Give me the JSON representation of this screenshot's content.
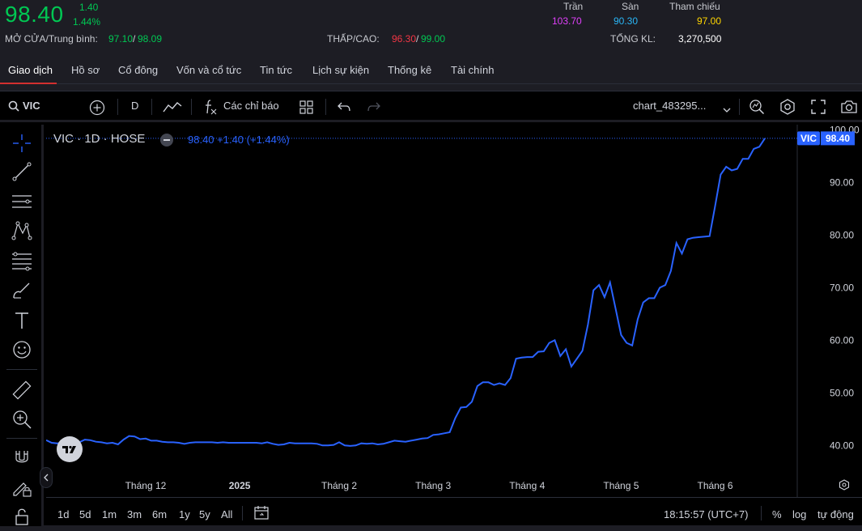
{
  "quote": {
    "price": "98.40",
    "change": "1.40",
    "change_pct": "1.44%",
    "open_avg_label": "MỞ CỬA/Trung bình:",
    "open": "97.10",
    "sep": "/",
    "avg": "98.09",
    "lowhigh_label": "THẤP/CAO:",
    "low": "96.30",
    "high": "99.00",
    "ceiling_label": "Trần",
    "ceiling": "103.70",
    "floor_label": "Sàn",
    "floor": "90.30",
    "ref_label": "Tham chiếu",
    "ref": "97.00",
    "vol_label": "TỔNG KL:",
    "volume": "3,270,500"
  },
  "tabs": [
    "Giao dịch",
    "Hồ sơ",
    "Cổ đông",
    "Vốn và cổ tức",
    "Tin tức",
    "Lịch sự kiện",
    "Thống kê",
    "Tài chính"
  ],
  "toolbar": {
    "symbol": "VIC",
    "interval": "D",
    "indicators": "Các chỉ báo",
    "chart_name": "chart_483295..."
  },
  "legend": {
    "title": "VIC · 1D · HOSE",
    "values": "98.40  +1.40 (+1.44%)"
  },
  "price_tag": {
    "symbol": "VIC",
    "value": "98.40"
  },
  "bottombar": {
    "ranges": [
      "1d",
      "5d",
      "1m",
      "3m",
      "6m",
      "1y",
      "5y",
      "All"
    ],
    "time": "18:15:57 (UTC+7)",
    "pct": "%",
    "log": "log",
    "auto": "tự động"
  },
  "colors": {
    "up": "#00c853",
    "down": "#f23645",
    "ceiling": "#e040fb",
    "floor": "#29b6f6",
    "ref": "#ffd600",
    "line": "#2962ff"
  },
  "chart_data": {
    "type": "line",
    "yticks": [
      "100.00",
      "90.00",
      "80.00",
      "70.00",
      "60.00",
      "50.00",
      "40.00"
    ],
    "ylim": [
      36.5,
      101
    ],
    "xticks": [
      {
        "label": "Tháng 12",
        "x": 18
      },
      {
        "label": "2025",
        "x": 35
      },
      {
        "label": "Tháng 2",
        "x": 53
      },
      {
        "label": "Tháng 3",
        "x": 70
      },
      {
        "label": "Tháng 4",
        "x": 87
      },
      {
        "label": "Tháng 5",
        "x": 104
      },
      {
        "label": "Tháng 6",
        "x": 121
      }
    ],
    "series": [
      {
        "values": [
          41.0,
          40.5,
          40.4,
          40.5,
          40.4,
          40.4,
          40.6,
          41.1,
          41.0,
          40.7,
          40.6,
          40.4,
          40.5,
          40.2,
          41.1,
          41.8,
          41.7,
          41.2,
          41.3,
          40.9,
          40.9,
          40.7,
          40.6,
          40.6,
          40.5,
          40.3,
          40.5,
          40.6,
          40.6,
          40.6,
          40.6,
          40.5,
          40.6,
          40.5,
          40.5,
          40.5,
          40.5,
          40.5,
          40.5,
          40.4,
          40.6,
          40.3,
          40.1,
          40.2,
          40.5,
          40.4,
          40.4,
          40.4,
          40.4,
          40.3,
          40.0,
          40.0,
          40.1,
          40.6,
          40.0,
          39.9,
          40.0,
          40.4,
          40.3,
          40.4,
          40.2,
          40.3,
          40.6,
          40.9,
          40.8,
          40.7,
          40.9,
          41.1,
          41.3,
          41.4,
          42.0,
          42.1,
          42.3,
          42.5,
          45.2,
          47.2,
          47.3,
          48.3,
          51.3,
          52.0,
          52.0,
          51.5,
          51.8,
          51.5,
          52.8,
          56.5,
          56.7,
          56.8,
          56.8,
          57.8,
          57.9,
          59.5,
          60.0,
          57.0,
          58.3,
          55.0,
          56.5,
          58.0,
          63.0,
          69.5,
          70.5,
          68.2,
          71.0,
          66.0,
          61.0,
          59.5,
          59.0,
          64.0,
          67.2,
          68.0,
          68.0,
          70.0,
          70.5,
          73.2,
          78.5,
          76.5,
          79.2,
          79.5,
          79.6,
          79.7,
          79.8,
          85.5,
          91.5,
          93.0,
          92.3,
          92.6,
          94.5,
          94.5,
          96.4,
          96.8,
          98.4
        ]
      }
    ]
  }
}
